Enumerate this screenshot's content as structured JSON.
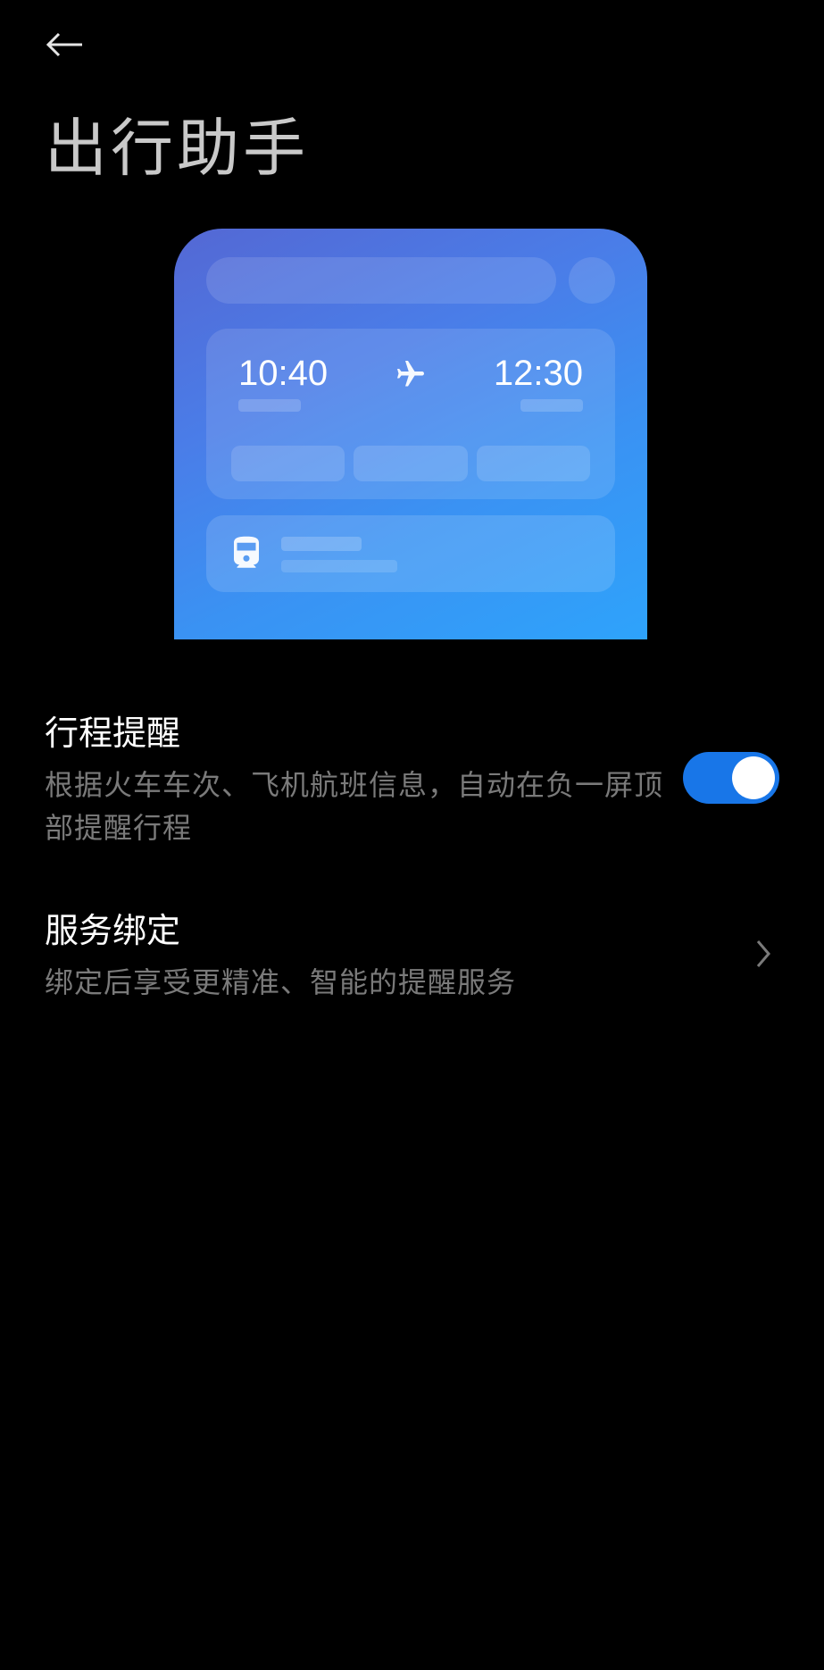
{
  "header": {
    "page_title": "出行助手"
  },
  "preview": {
    "flight": {
      "departure_time": "10:40",
      "arrival_time": "12:30"
    }
  },
  "settings": {
    "trip_reminder": {
      "title": "行程提醒",
      "description": "根据火车车次、飞机航班信息，自动在负一屏顶部提醒行程",
      "enabled": true
    },
    "service_binding": {
      "title": "服务绑定",
      "description": "绑定后享受更精准、智能的提醒服务"
    }
  }
}
